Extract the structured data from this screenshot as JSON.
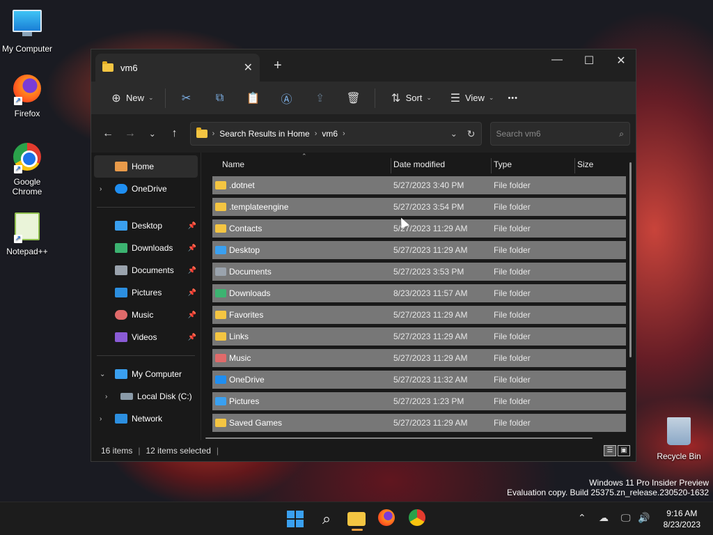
{
  "desktop": {
    "icons": [
      {
        "label": "My Computer",
        "icon": "monitor-icon"
      },
      {
        "label": "Firefox",
        "icon": "firefox-icon"
      },
      {
        "label": "Google Chrome",
        "icon": "chrome-icon"
      },
      {
        "label": "Notepad++",
        "icon": "notepadpp-icon"
      },
      {
        "label": "Recycle Bin",
        "icon": "recycle-bin-icon"
      }
    ],
    "watermark_line1": "Windows 11 Pro Insider Preview",
    "watermark_line2": "Evaluation copy. Build 25375.zn_release.230520-1632"
  },
  "window": {
    "tab_title": "vm6",
    "tab_close": "✕",
    "new_tab": "+",
    "controls": {
      "minimize": "—",
      "maximize": "☐",
      "close": "✕"
    }
  },
  "toolbar": {
    "new_label": "New",
    "sort_label": "Sort",
    "view_label": "View",
    "more": "•••"
  },
  "address": {
    "segments": [
      "Search Results in Home",
      "vm6"
    ],
    "search_placeholder": "Search vm6"
  },
  "sidebar": {
    "items": [
      {
        "label": "Home",
        "icon": "home-icon",
        "active": true
      },
      {
        "label": "OneDrive",
        "icon": "onedrive-icon"
      },
      {
        "label": "Desktop",
        "icon": "desktop-icon",
        "pinned": true
      },
      {
        "label": "Downloads",
        "icon": "downloads-icon",
        "pinned": true
      },
      {
        "label": "Documents",
        "icon": "documents-icon",
        "pinned": true
      },
      {
        "label": "Pictures",
        "icon": "pictures-icon",
        "pinned": true
      },
      {
        "label": "Music",
        "icon": "music-icon",
        "pinned": true
      },
      {
        "label": "Videos",
        "icon": "videos-icon",
        "pinned": true
      },
      {
        "label": "My Computer",
        "icon": "computer-icon"
      },
      {
        "label": "Local Disk (C:)",
        "icon": "disk-icon"
      },
      {
        "label": "Network",
        "icon": "network-icon"
      }
    ]
  },
  "columns": {
    "name": "Name",
    "date": "Date modified",
    "type": "Type",
    "size": "Size"
  },
  "files": [
    {
      "name": ".dotnet",
      "date": "5/27/2023 3:40 PM",
      "type": "File folder",
      "icon": "folder-icon",
      "color": "#f4c542"
    },
    {
      "name": ".templateengine",
      "date": "5/27/2023 3:54 PM",
      "type": "File folder",
      "icon": "folder-icon",
      "color": "#f4c542"
    },
    {
      "name": "Contacts",
      "date": "5/27/2023 11:29 AM",
      "type": "File folder",
      "icon": "folder-icon",
      "color": "#f4c542"
    },
    {
      "name": "Desktop",
      "date": "5/27/2023 11:29 AM",
      "type": "File folder",
      "icon": "desktop-icon",
      "color": "#3aa0f0"
    },
    {
      "name": "Documents",
      "date": "5/27/2023 3:53 PM",
      "type": "File folder",
      "icon": "documents-icon",
      "color": "#9aa3ad"
    },
    {
      "name": "Downloads",
      "date": "8/23/2023 11:57 AM",
      "type": "File folder",
      "icon": "downloads-icon",
      "color": "#3cb371"
    },
    {
      "name": "Favorites",
      "date": "5/27/2023 11:29 AM",
      "type": "File folder",
      "icon": "folder-icon",
      "color": "#f4c542"
    },
    {
      "name": "Links",
      "date": "5/27/2023 11:29 AM",
      "type": "File folder",
      "icon": "folder-icon",
      "color": "#f4c542"
    },
    {
      "name": "Music",
      "date": "5/27/2023 11:29 AM",
      "type": "File folder",
      "icon": "music-icon",
      "color": "#e06a6a"
    },
    {
      "name": "OneDrive",
      "date": "5/27/2023 11:32 AM",
      "type": "File folder",
      "icon": "onedrive-icon",
      "color": "#1f8ef1"
    },
    {
      "name": "Pictures",
      "date": "5/27/2023 1:23 PM",
      "type": "File folder",
      "icon": "pictures-icon",
      "color": "#3aa0f0"
    },
    {
      "name": "Saved Games",
      "date": "5/27/2023 11:29 AM",
      "type": "File folder",
      "icon": "folder-icon",
      "color": "#f4c542"
    }
  ],
  "status": {
    "items": "16 items",
    "selected": "12 items selected"
  },
  "taskbar": {
    "time": "9:16 AM",
    "date": "8/23/2023"
  },
  "colors": {
    "selection": "#777777",
    "accent": "#3aa0f0",
    "folder": "#f4c542"
  }
}
